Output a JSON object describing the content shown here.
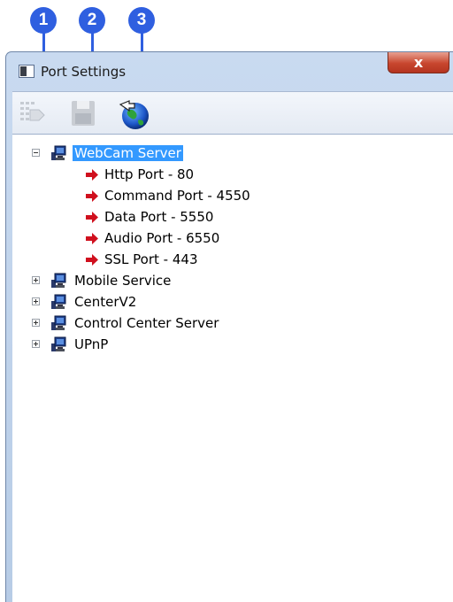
{
  "callouts": [
    "1",
    "2",
    "3"
  ],
  "window": {
    "title": "Port Settings",
    "close_glyph": "x"
  },
  "toolbar": {
    "buttons": [
      {
        "icon": "network-connect-icon",
        "enabled": false
      },
      {
        "icon": "save-floppy-icon",
        "enabled": false
      },
      {
        "icon": "globe-upnp-icon",
        "enabled": true
      }
    ]
  },
  "tree": {
    "nodes": [
      {
        "label": "WebCam Server",
        "expanded": true,
        "selected": true,
        "children": [
          "Http Port - 80",
          "Command Port - 4550",
          "Data Port - 5550",
          "Audio Port - 6550",
          "SSL Port - 443"
        ]
      },
      {
        "label": "Mobile Service",
        "expanded": false,
        "selected": false
      },
      {
        "label": "CenterV2",
        "expanded": false,
        "selected": false
      },
      {
        "label": "Control Center Server",
        "expanded": false,
        "selected": false
      },
      {
        "label": "UPnP",
        "expanded": false,
        "selected": false
      }
    ]
  },
  "colors": {
    "callout": "#2f5fe0",
    "selection": "#3399ff",
    "arrow": "#d0101e"
  }
}
